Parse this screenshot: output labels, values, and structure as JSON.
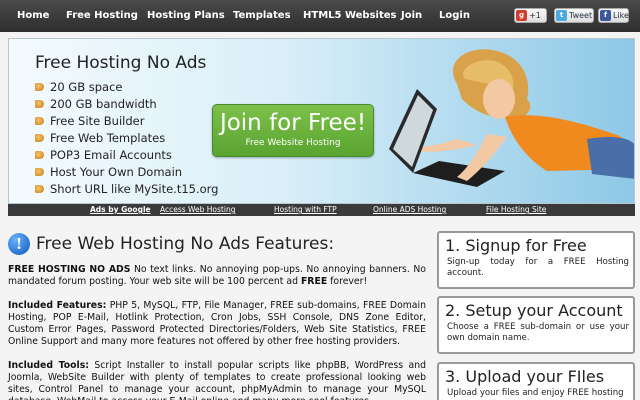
{
  "nav": {
    "items": [
      "Home",
      "Free Hosting",
      "Hosting Plans",
      "Templates",
      "HTML5 Websites",
      "Join",
      "Login"
    ],
    "gplus": "+1",
    "twitter": "Tweet",
    "facebook": "Like"
  },
  "hero": {
    "title": "Free Hosting No Ads",
    "features": [
      "20 GB space",
      "200 GB bandwidth",
      "Free Site Builder",
      "Free Web Templates",
      "POP3 Email Accounts",
      "Host Your Own Domain",
      "Short URL like MySite.t15.org"
    ],
    "join_label": "Join for Free!",
    "join_sub": "Free Website Hosting"
  },
  "subnav": {
    "items": [
      "Ads by Google",
      "Access Web Hosting",
      "Hosting with FTP",
      "Online ADS Hosting",
      "File Hosting Site"
    ]
  },
  "main": {
    "title": "Free Web Hosting No Ads Features:",
    "p1_bold": "FREE HOSTING NO ADS",
    "p1_text": " No text links. No annoying pop-ups. No annoying banners. No mandated forum posting. Your web site will be 100 percent ad ",
    "p1_bold2": "FREE",
    "p1_end": " forever!",
    "p2_bold": "Included Features:",
    "p2_text": " PHP 5, MySQL, FTP, File Manager, FREE sub-domains, FREE Domain Hosting, POP E-Mail, Hotlink Protection, Cron Jobs, SSH Console, DNS Zone Editor, Custom Error Pages, Password Protected Directories/Folders, Web Site Statistics, FREE Online Support and many more features not offered by other free hosting providers.",
    "p3_bold": "Included Tools:",
    "p3_text": " Script Installer to install popular scripts like phpBB, WordPress and Joomla, WebSite Builder with plenty of templates to create professional looking web sites, Control Panel to manage your account, phpMyAdmin to manage your MySQL database, WebMail to access your E-Mail online and many more cool features."
  },
  "steps": [
    {
      "title": "1. Signup for Free",
      "text": "Sign-up today for a FREE Hosting account."
    },
    {
      "title": "2. Setup your Account",
      "text": "Choose a FREE sub-domain or use your own domain name."
    },
    {
      "title": "3. Upload your FIles",
      "text": "Upload your files and enjoy FREE hosting"
    }
  ]
}
